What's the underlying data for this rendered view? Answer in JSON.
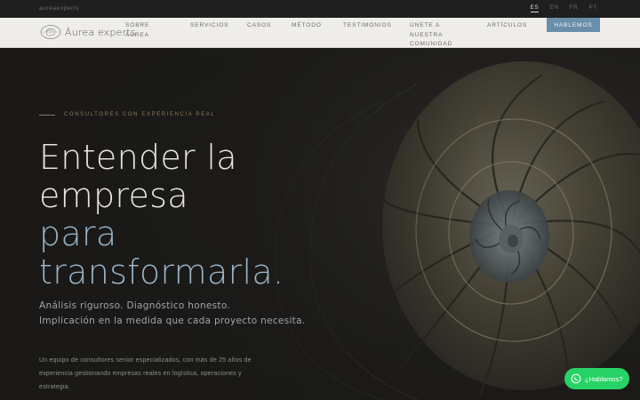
{
  "topbar": {
    "domain": "aureaexperts",
    "languages": [
      {
        "code": "ES",
        "active": true
      },
      {
        "code": "EN",
        "active": false
      },
      {
        "code": "FR",
        "active": false
      },
      {
        "code": "PT",
        "active": false
      }
    ]
  },
  "brand": {
    "logo_text": "Áurea experts",
    "logo_icon": "nautilus-logo-icon"
  },
  "nav": {
    "items": [
      {
        "lines": [
          "Sobre",
          "Áurea"
        ]
      },
      {
        "lines": [
          "Servicios"
        ]
      },
      {
        "lines": [
          "Casos"
        ]
      },
      {
        "lines": [
          "Método"
        ]
      },
      {
        "lines": [
          "Testimonios"
        ]
      },
      {
        "lines": [
          "Únete a",
          "nuestra",
          "comunidad"
        ]
      },
      {
        "lines": [
          "Artículos"
        ]
      }
    ],
    "cta_label": "HABLEMOS"
  },
  "hero": {
    "eyebrow": "CONSULTORES CON EXPERIENCIA REAL",
    "headline_line1": "Entender la",
    "headline_line2": "empresa",
    "headline_line3": "para",
    "headline_line4": "transformarla.",
    "subhead_line1": "Análisis riguroso. Diagnóstico honesto.",
    "subhead_line2": "Implicación en la medida que cada proyecto necesita.",
    "paragraph": "Un equipo de consultores senior especializados, con más de 25 años de experiencia gestionando empresas reales en logística, operaciones y estrategia."
  },
  "whatsapp": {
    "label": "¿Hablamos?",
    "icon": "whatsapp-icon"
  },
  "colors": {
    "accent_blue": "#6a8fab",
    "headline_blue": "#98b2c6",
    "eyebrow_gold": "#8c7d60",
    "whatsapp_green": "#27d366"
  }
}
